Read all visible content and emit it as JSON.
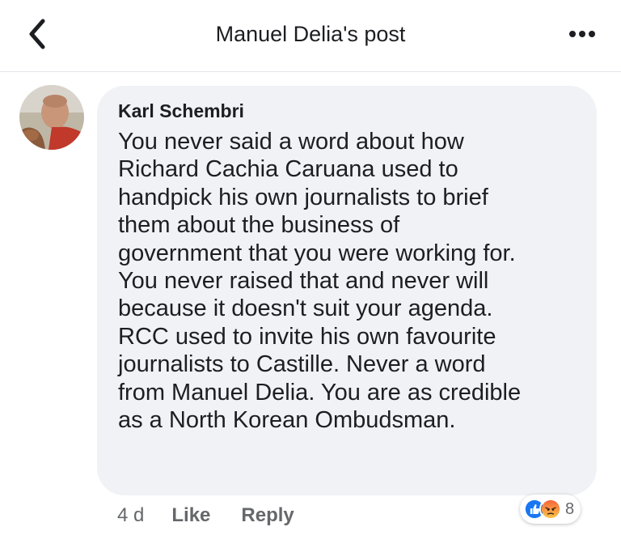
{
  "header": {
    "title": "Manuel Delia's post",
    "back_icon": "chevron-left-icon",
    "more_icon": "more-dots-icon"
  },
  "comment": {
    "author": "Karl Schembri",
    "text": "You never said a word about how\nRichard Cachia Caruana used to\nhandpick his own journalists to brief\nthem about the business of\ngovernment that you were working for.\nYou never raised that and never will\nbecause it doesn't suit your agenda.\nRCC used to invite his own favourite\njournalists to Castille. Never a word\nfrom Manuel Delia. You are as credible\nas a North Korean Ombudsman.",
    "time": "4 d",
    "like_label": "Like",
    "reply_label": "Reply",
    "reactions": {
      "icons": [
        "like-reaction-icon",
        "angry-reaction-icon"
      ],
      "count": "8"
    }
  },
  "colors": {
    "bubble": "#f0f2f5",
    "text": "#1c1e21",
    "meta": "#65676b",
    "like_blue": "#1877f2",
    "angry_top": "#f7653b",
    "angry_bottom": "#f9c54b"
  }
}
